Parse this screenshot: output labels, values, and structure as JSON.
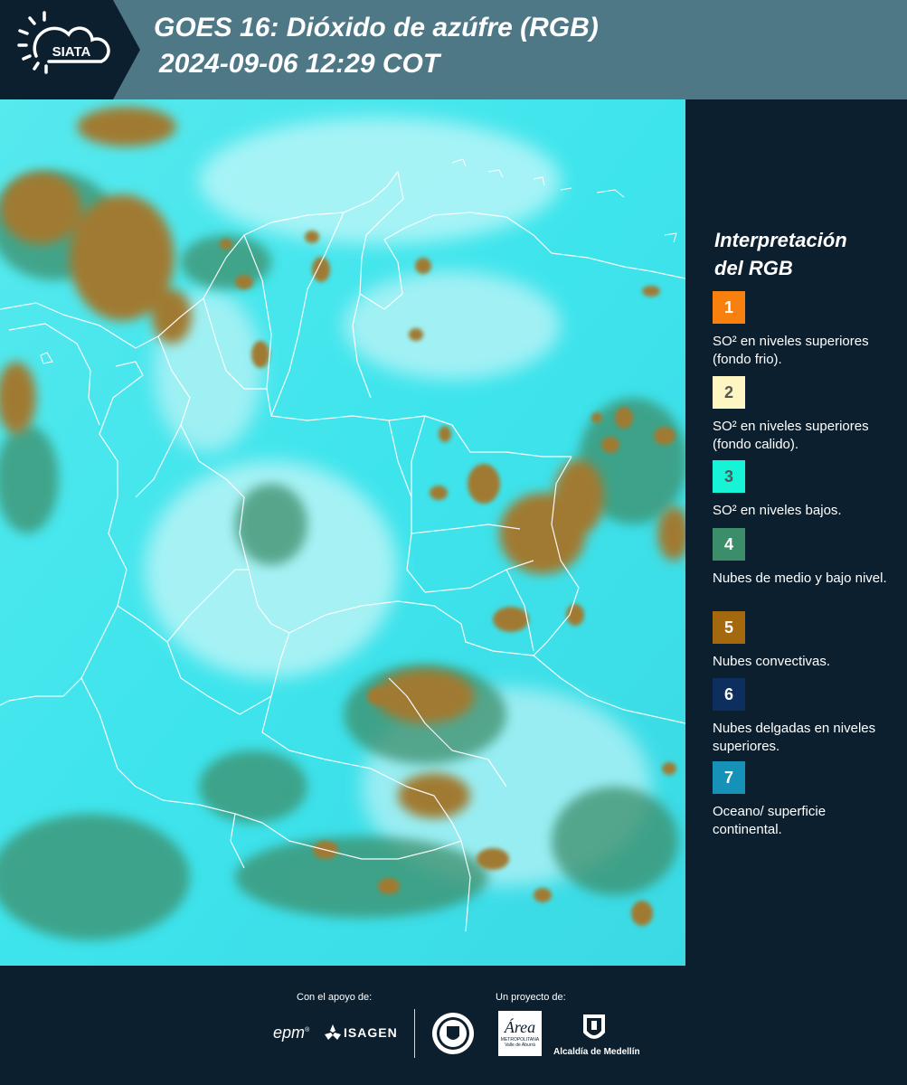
{
  "header": {
    "logo_text": "SIATA",
    "title_line1": "GOES 16: Dióxido de azúfre (RGB)",
    "title_line2": "2024-09-06 12:29 COT"
  },
  "legend": {
    "title_line1": "Interpretación",
    "title_line2": "del RGB",
    "items": [
      {
        "number": "1",
        "text": "SO² en niveles superiores (fondo frio).",
        "color": "#f7800e",
        "number_color": "#ffffff"
      },
      {
        "number": "2",
        "text": "SO² en niveles superiores (fondo calido).",
        "color": "#fdf6c3",
        "number_color": "#555555"
      },
      {
        "number": "3",
        "text": "SO² en niveles bajos.",
        "color": "#16f3d6",
        "number_color": "#555555"
      },
      {
        "number": "4",
        "text": "Nubes de medio y bajo nivel.",
        "color": "#3c8e6a",
        "number_color": "#ffffff"
      },
      {
        "number": "5",
        "text": "Nubes convectivas.",
        "color": "#a4690f",
        "number_color": "#ffffff"
      },
      {
        "number": "6",
        "text": "Nubes delgadas en niveles superiores.",
        "color": "#0c2f5f",
        "number_color": "#ffffff"
      },
      {
        "number": "7",
        "text": "Oceano/ superficie continental.",
        "color": "#1692b8",
        "number_color": "#ffffff"
      }
    ]
  },
  "footer": {
    "support_label": "Con el apoyo de:",
    "project_label": "Un proyecto de:",
    "epm_text": "epm",
    "isagen_text": "ISAGEN",
    "area_text": "Área",
    "area_sub1": "METROPOLITANA",
    "area_sub2": "Valle de Aburrá",
    "alcaldia_text": "Alcaldía de Medellín"
  },
  "colors": {
    "header_bg": "#4f7887",
    "panel_bg": "#0c1f2e",
    "map_surface": "#3fe6ee",
    "map_convective": "#a07a32"
  }
}
